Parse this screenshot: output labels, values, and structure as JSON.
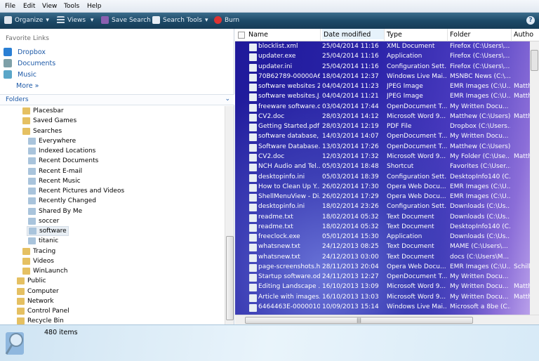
{
  "menu": [
    "File",
    "Edit",
    "View",
    "Tools",
    "Help"
  ],
  "toolbar": {
    "organize": "Organize",
    "views": "Views",
    "save_search": "Save Search",
    "search_tools": "Search Tools",
    "burn": "Burn"
  },
  "favorites": {
    "header": "Favorite Links",
    "items": [
      "Dropbox",
      "Documents",
      "Music"
    ],
    "more": "More »"
  },
  "folders_label": "Folders",
  "tree": [
    {
      "label": "Placesbar",
      "indent": 1
    },
    {
      "label": "Saved Games",
      "indent": 1
    },
    {
      "label": "Searches",
      "indent": 1
    },
    {
      "label": "Everywhere",
      "indent": 2
    },
    {
      "label": "Indexed Locations",
      "indent": 2
    },
    {
      "label": "Recent Documents",
      "indent": 2
    },
    {
      "label": "Recent E-mail",
      "indent": 2
    },
    {
      "label": "Recent Music",
      "indent": 2
    },
    {
      "label": "Recent Pictures and Videos",
      "indent": 2
    },
    {
      "label": "Recently Changed",
      "indent": 2
    },
    {
      "label": "Shared By Me",
      "indent": 2
    },
    {
      "label": "soccer",
      "indent": 2
    },
    {
      "label": "software",
      "indent": 2,
      "selected": true
    },
    {
      "label": "titanic",
      "indent": 2
    },
    {
      "label": "Tracing",
      "indent": 1
    },
    {
      "label": "Videos",
      "indent": 1
    },
    {
      "label": "WinLaunch",
      "indent": 1
    },
    {
      "label": "Public",
      "indent": 0
    },
    {
      "label": "Computer",
      "indent": 0
    },
    {
      "label": "Network",
      "indent": 0
    },
    {
      "label": "Control Panel",
      "indent": 0
    },
    {
      "label": "Recycle Bin",
      "indent": 0
    }
  ],
  "columns": [
    "Name",
    "Date modified",
    "Type",
    "Folder",
    "Autho"
  ],
  "files": [
    [
      "blocklist.xml",
      "25/04/2014 11:16",
      "XML Document",
      "Firefox (C:\\Users\\...",
      ""
    ],
    [
      "updater.exe",
      "25/04/2014 11:16",
      "Application",
      "Firefox (C:\\Users\\...",
      ""
    ],
    [
      "updater.ini",
      "25/04/2014 11:16",
      "Configuration Sett...",
      "Firefox (C:\\Users\\...",
      ""
    ],
    [
      "70B62789-00000A6...",
      "18/04/2014 12:37",
      "Windows Live Mai...",
      "MSNBC News (C:\\...",
      ""
    ],
    [
      "software websites 2....",
      "04/04/2014 11:23",
      "JPEG Image",
      "EMR Images (C:\\U...",
      "Matth"
    ],
    [
      "software websites.J...",
      "04/04/2014 11:21",
      "JPEG Image",
      "EMR Images (C:\\U...",
      "Matth"
    ],
    [
      "freeware software.odt",
      "03/04/2014 17:44",
      "OpenDocument T...",
      "My Written Docu...",
      ""
    ],
    [
      "CV2.doc",
      "28/03/2014 14:12",
      "Microsoft Word 9...",
      "Matthew (C:\\Users)",
      "Matth"
    ],
    [
      "Getting Started.pdf",
      "28/03/2014 12:19",
      "PDF File",
      "Dropbox (C:\\Users...",
      ""
    ],
    [
      "software database, ...",
      "14/03/2014 14:07",
      "OpenDocument T...",
      "My Written Docu...",
      ""
    ],
    [
      "Software Database....",
      "13/03/2014 17:26",
      "OpenDocument T...",
      "Matthew (C:\\Users)",
      ""
    ],
    [
      "CV2.doc",
      "12/03/2014 17:32",
      "Microsoft Word 9...",
      "My Folder (C:\\Use...",
      "Matth"
    ],
    [
      "NCH Audio and Tel...",
      "05/03/2014 18:48",
      "Shortcut",
      "Favorites (C:\\User...",
      ""
    ],
    [
      "desktopinfo.ini",
      "05/03/2014 18:39",
      "Configuration Sett...",
      "DesktopInfo140 (C...",
      ""
    ],
    [
      "How to Clean Up Y...",
      "26/02/2014 17:30",
      "Opera Web Docu...",
      "EMR Images (C:\\U...",
      ""
    ],
    [
      "ShellMenuView - Di...",
      "26/02/2014 17:29",
      "Opera Web Docu...",
      "EMR Images (C:\\U...",
      ""
    ],
    [
      "desktopinfo.ini",
      "18/02/2014 23:26",
      "Configuration Sett...",
      "Downloads (C:\\Us...",
      ""
    ],
    [
      "readme.txt",
      "18/02/2014 05:32",
      "Text Document",
      "Downloads (C:\\Us...",
      ""
    ],
    [
      "readme.txt",
      "18/02/2014 05:32",
      "Text Document",
      "DesktopInfo140 (C...",
      ""
    ],
    [
      "freeclock.exe",
      "05/01/2014 15:30",
      "Application",
      "Downloads (C:\\Us...",
      ""
    ],
    [
      "whatsnew.txt",
      "24/12/2013 08:25",
      "Text Document",
      "MAME (C:\\Users\\...",
      ""
    ],
    [
      "whatsnew.txt",
      "24/12/2013 03:00",
      "Text Document",
      "docs (C:\\Users\\M...",
      ""
    ],
    [
      "page-screenshots.h...",
      "28/11/2013 20:04",
      "Opera Web Docu...",
      "EMR Images (C:\\U...",
      "Schille"
    ],
    [
      "Startup software.odt",
      "24/11/2013 12:27",
      "OpenDocument T...",
      "My Written Docu...",
      ""
    ],
    [
      "Editing Landscape ...",
      "16/10/2013 13:09",
      "Microsoft Word 9...",
      "My Written Docu...",
      "Matth"
    ],
    [
      "Article with images....",
      "16/10/2013 13:03",
      "Microsoft Word 9...",
      "My Written Docu...",
      "Matth"
    ],
    [
      "6464463E-0000010B....",
      "10/09/2013 15:14",
      "Windows Live Mai...",
      "Microsoft a 8be (C...",
      ""
    ]
  ],
  "status": {
    "count": "480 items"
  }
}
